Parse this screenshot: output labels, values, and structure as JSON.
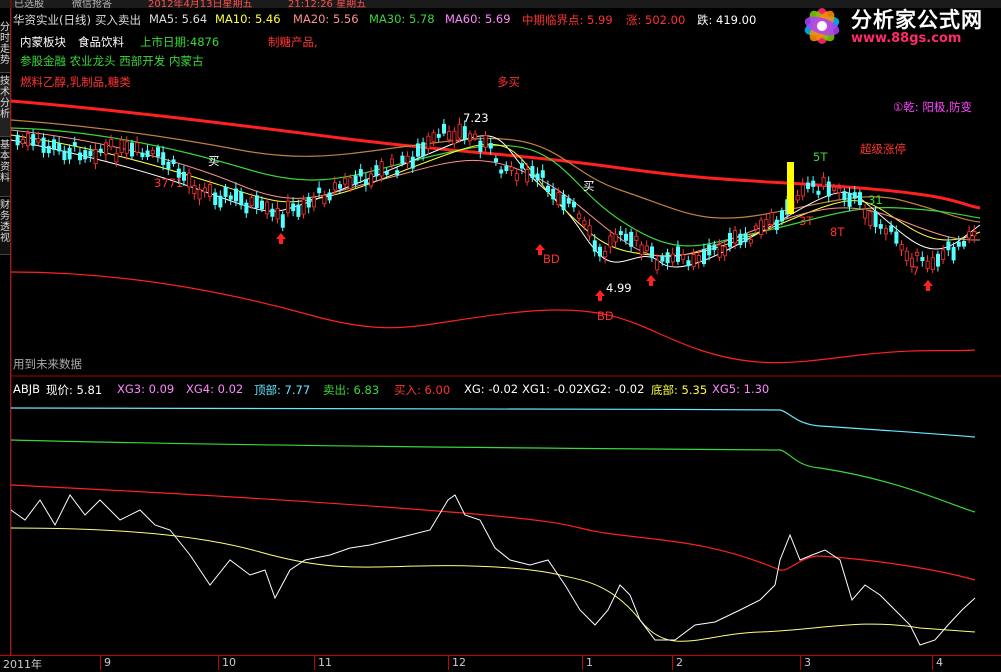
{
  "colors": {
    "up": "#ff3232",
    "down": "#54ffff",
    "ma_red": "#ff2020",
    "green": "#39d739",
    "yellow": "#ffff00",
    "white": "#ffffff",
    "magenta": "#ff44ff"
  },
  "top_strip": [
    "已选股",
    "微信抢答",
    "2012年4月13日星期五",
    "21:12:26 星期五"
  ],
  "sidebar_tabs": [
    "分时走势",
    "技术分析",
    "基本资料",
    "财务透视"
  ],
  "header": {
    "stock": "华资实业(日线)",
    "indicator": "买入卖出",
    "ma5": "MA5: 5.64",
    "ma10": "MA10: 5.46",
    "ma20": "MA20: 5.56",
    "ma30": "MA30: 5.78",
    "ma60": "MA60: 5.69",
    "critical": "中期临界点: 5.99",
    "rise": "涨: 502.00",
    "fall": "跌: 419.00"
  },
  "info": {
    "line1_a": "内蒙板块",
    "line1_b": "食品饮料",
    "line1_c": "上市日期:4876",
    "line1_d": "制糖产品,",
    "line2": "参股金融 农业龙头 西部开发 内蒙古",
    "line3": "燃料乙醇,乳制品,糖类",
    "duomai": "多买",
    "qian": "①乾: 阳极,防变",
    "chaoji": "超级涨停",
    "future": "用到未来数据"
  },
  "price_labels": {
    "high": "7.23",
    "low": "4.99",
    "mai1": "买",
    "mai2": "买",
    "n3771": "3771",
    "t5": "5T",
    "t31": "31",
    "t3t": "3T",
    "t8t": "8T",
    "bd1": "BD",
    "bd2": "BD",
    "n7": "7"
  },
  "sub_header": {
    "name": "ABJB",
    "price": "现价: 5.81",
    "xg3": "XG3: 0.09",
    "xg4": "XG4: 0.02",
    "top": "顶部: 7.77",
    "sell": "卖出: 6.83",
    "buy": "买入: 6.00",
    "xg": "XG: -0.02",
    "xg1": "XG1: -0.02",
    "xg2": "XG2: -0.02",
    "bottom": "底部: 5.35",
    "xg5": "XG5: 1.30"
  },
  "x_axis": [
    "2011年",
    "9",
    "10",
    "11",
    "12",
    "1",
    "2",
    "3",
    "4"
  ],
  "logo": {
    "text": "分析家公式网",
    "url": "www.88gs.com"
  }
}
